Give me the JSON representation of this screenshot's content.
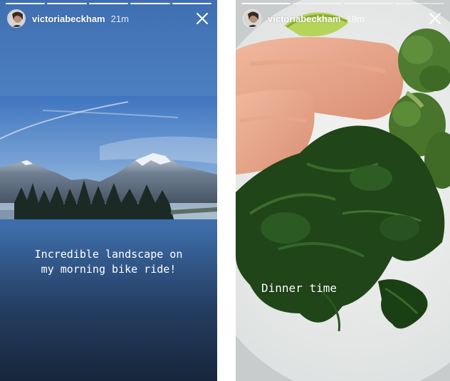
{
  "stories": [
    {
      "username": "victoriabeckham",
      "timestamp": "21m",
      "caption": "Incredible landscape on my morning bike ride!",
      "caption_line1": "Incredible landscape on",
      "caption_line2": "my morning bike ride!",
      "progress_segments_done": 5,
      "progress_segments_total": 5,
      "close_icon": "close-icon",
      "photo": "mountain-lake-landscape"
    },
    {
      "username": "victoriabeckham",
      "timestamp": "19m",
      "caption": "Dinner time",
      "progress_segments_done": 1,
      "progress_segments_total": 4,
      "close_icon": "close-icon",
      "photo": "salmon-spinach-broccoli-plate"
    }
  ],
  "colors": {
    "story_bg_top": "#4c7fc0",
    "story_bg_bottom": "#16263c",
    "text": "#ffffff",
    "divider": "#ffffff"
  }
}
